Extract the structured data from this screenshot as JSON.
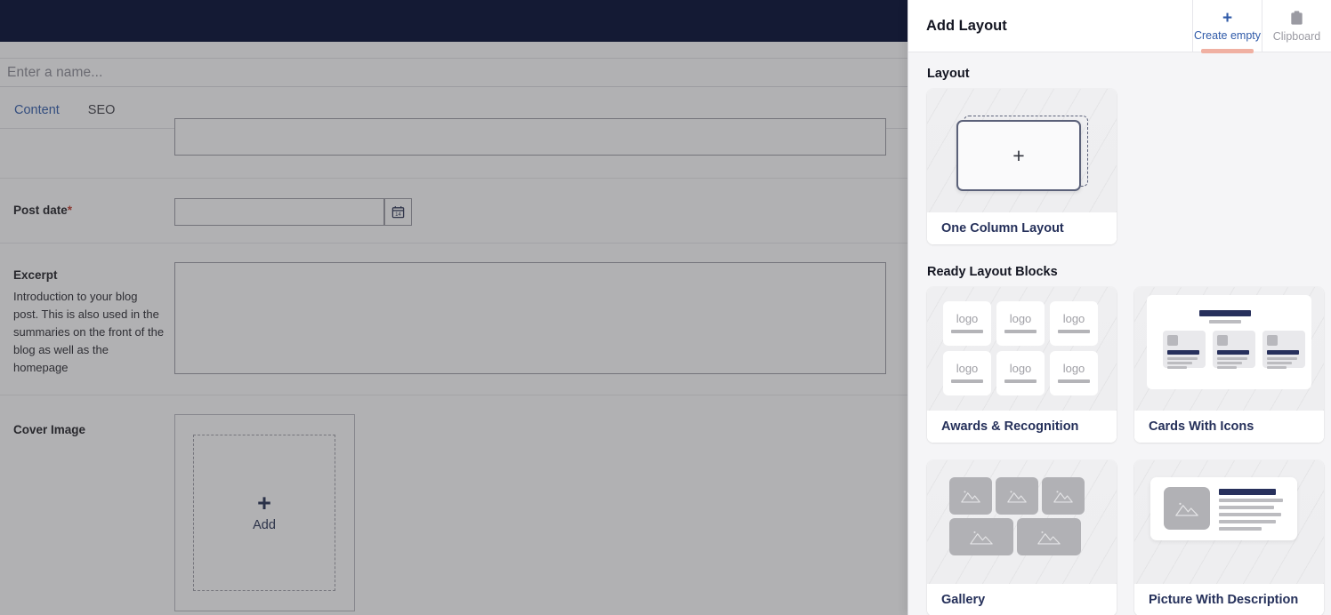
{
  "app": {
    "name_field": {
      "placeholder": "Enter a name..."
    },
    "tabs": [
      {
        "label": "Content",
        "active": true
      },
      {
        "label": "SEO",
        "active": false
      }
    ],
    "form_rows": [
      {
        "label": "Post date",
        "required_marker": "*",
        "help": "",
        "value": ""
      },
      {
        "label": "Excerpt",
        "required_marker": "",
        "help": "Introduction to your blog post. This is also used in the summaries on the front of the blog as well as the homepage",
        "value": ""
      },
      {
        "label": "Cover Image",
        "required_marker": "",
        "help": "",
        "value": ""
      }
    ],
    "cover_image": {
      "add_plus": "+",
      "add_label": "Add"
    },
    "calendar_icon": "calendar-icon"
  },
  "panel": {
    "title": "Add Layout",
    "header_tabs": [
      {
        "label": "Create empty",
        "icon": "plus-icon",
        "glyph": "+",
        "active": true
      },
      {
        "label": "Clipboard",
        "icon": "clipboard-icon",
        "glyph": "",
        "active": false
      }
    ],
    "sections": [
      {
        "title": "Layout",
        "cards": [
          {
            "label": "One Column Layout",
            "thumb": "one-column",
            "plus": "+"
          }
        ]
      },
      {
        "title": "Ready Layout Blocks",
        "cards": [
          {
            "label": "Awards & Recognition",
            "thumb": "awards",
            "logo_text": "logo"
          },
          {
            "label": "Cards With Icons",
            "thumb": "cards-with-icons"
          },
          {
            "label": "Gallery",
            "thumb": "gallery"
          },
          {
            "label": "Picture With Description",
            "thumb": "picture-with-description"
          }
        ]
      }
    ]
  },
  "colors": {
    "topbar": "#141a34",
    "accent_blue": "#2f5aa8",
    "tab_underline": "#e8846f",
    "panel_bg": "#f5f5f7",
    "card_label_text": "#25305a",
    "navy_block": "#27305c",
    "required": "#c0392b"
  }
}
